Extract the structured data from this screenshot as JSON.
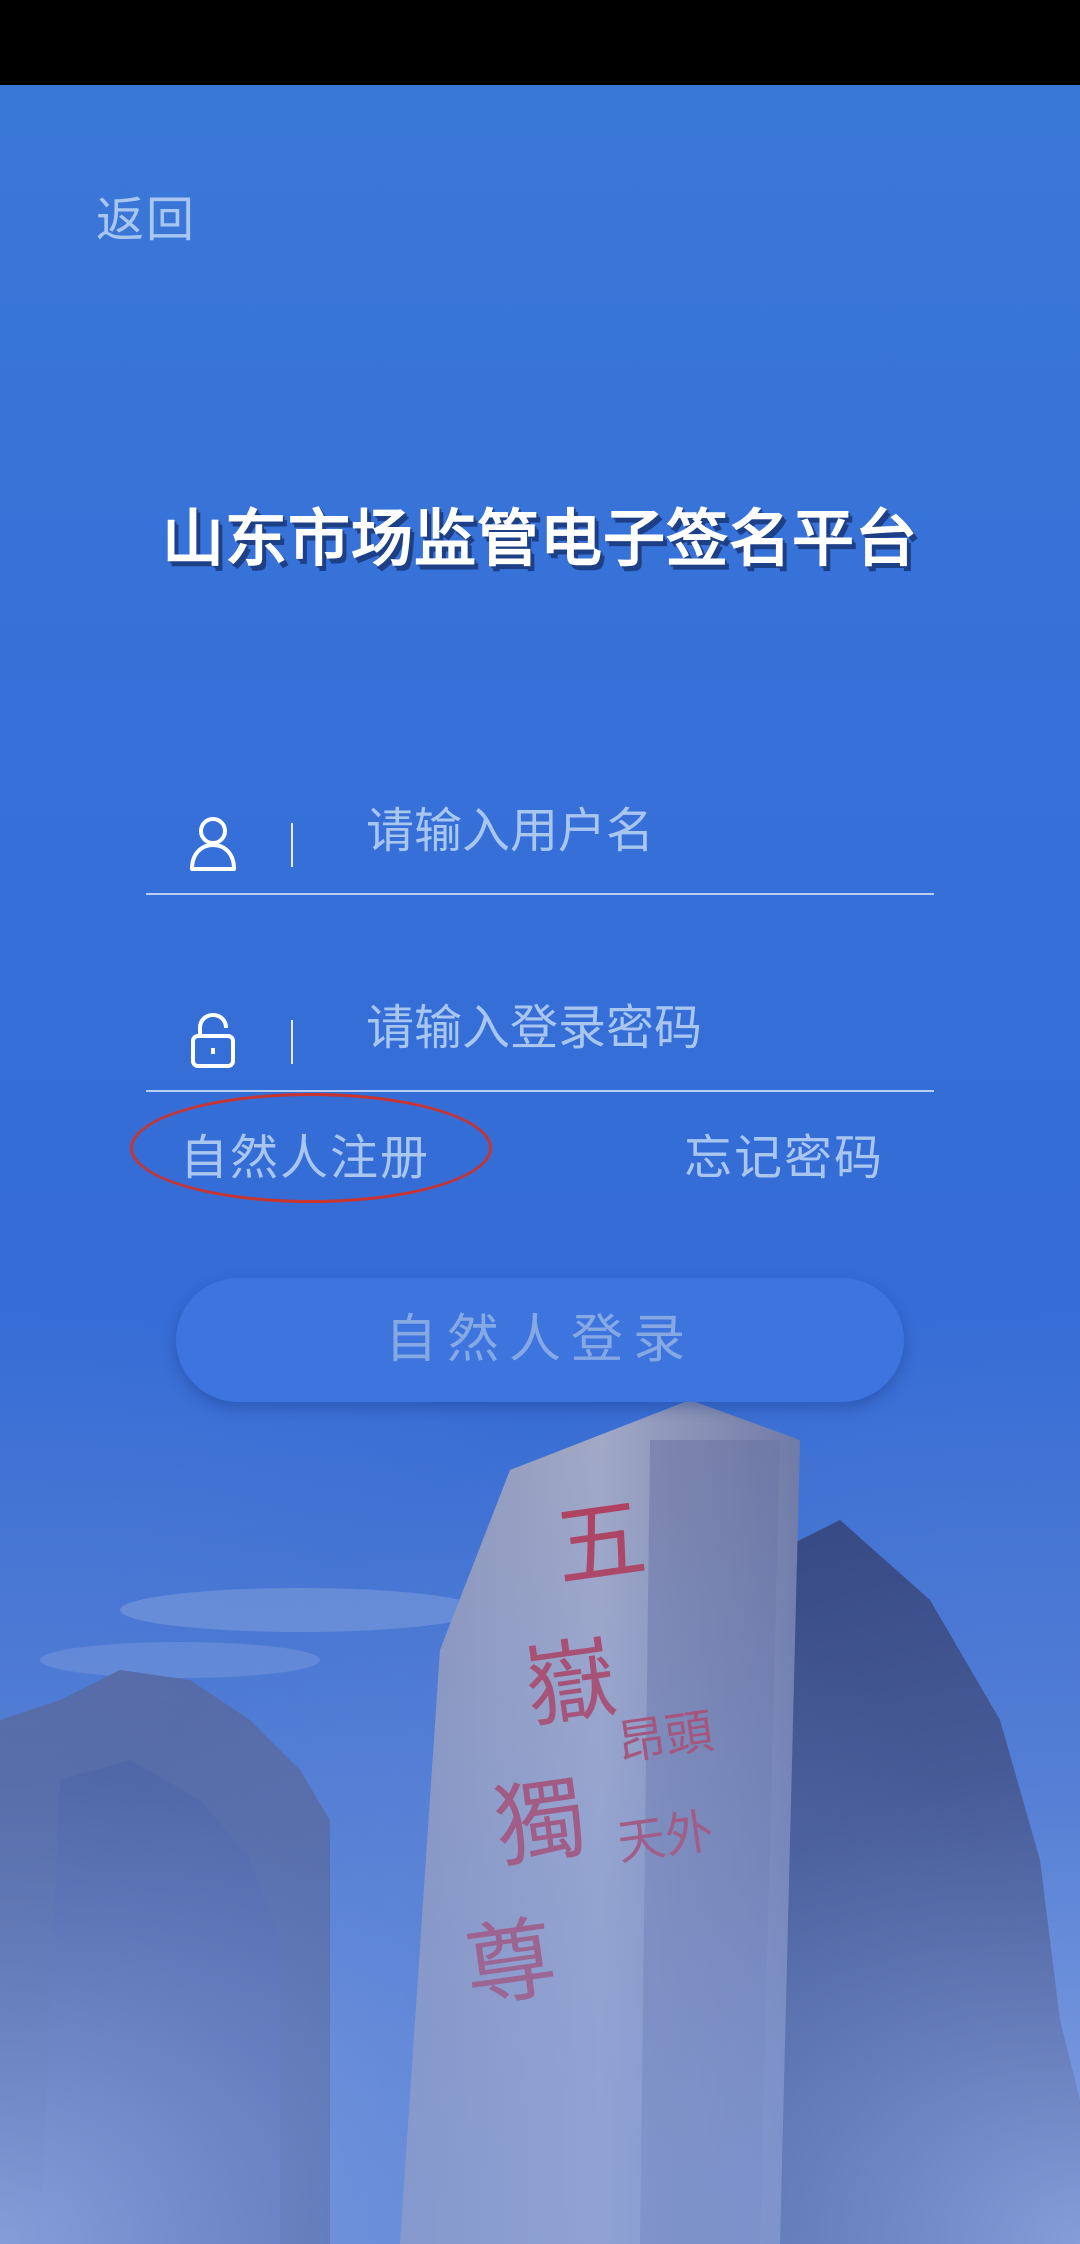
{
  "header": {
    "back_label": "返回"
  },
  "app": {
    "title": "山东市场监管电子签名平台"
  },
  "form": {
    "username_placeholder": "请输入用户名",
    "username_value": "",
    "password_placeholder": "请输入登录密码",
    "password_value": "",
    "username_icon": "user-icon",
    "password_icon": "lock-icon"
  },
  "links": {
    "register_label": "自然人注册",
    "forgot_label": "忘记密码"
  },
  "actions": {
    "login_label": "自然人登录"
  },
  "colors": {
    "background": "#3670d8",
    "link_text": "#a9c6ef",
    "annotation_circle": "#c9342f"
  }
}
